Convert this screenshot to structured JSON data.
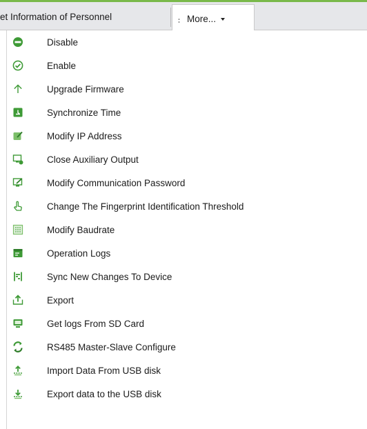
{
  "toolbar": {
    "personnel_label": "et Information of Personnel",
    "more_label": "More..."
  },
  "menu": {
    "items": [
      {
        "label": "Disable",
        "icon": "disable-icon"
      },
      {
        "label": "Enable",
        "icon": "enable-icon"
      },
      {
        "label": "Upgrade Firmware",
        "icon": "upgrade-firmware-icon"
      },
      {
        "label": "Synchronize Time",
        "icon": "synchronize-time-icon"
      },
      {
        "label": "Modify IP Address",
        "icon": "modify-ip-icon"
      },
      {
        "label": "Close Auxiliary Output",
        "icon": "close-auxiliary-output-icon"
      },
      {
        "label": "Modify Communication Password",
        "icon": "modify-communication-password-icon"
      },
      {
        "label": "Change The Fingerprint Identification Threshold",
        "icon": "fingerprint-threshold-icon"
      },
      {
        "label": "Modify Baudrate",
        "icon": "modify-baudrate-icon"
      },
      {
        "label": "Operation Logs",
        "icon": "operation-logs-icon"
      },
      {
        "label": "Sync New Changes To Device",
        "icon": "sync-changes-icon"
      },
      {
        "label": "Export",
        "icon": "export-icon"
      },
      {
        "label": "Get logs From SD Card",
        "icon": "sd-card-logs-icon"
      },
      {
        "label": "RS485 Master-Slave Configure",
        "icon": "rs485-configure-icon"
      },
      {
        "label": "Import Data From USB disk",
        "icon": "usb-import-icon"
      },
      {
        "label": "Export data to the USB disk",
        "icon": "usb-export-icon"
      }
    ]
  },
  "colors": {
    "accent_green": "#79b94a",
    "icon_green": "#3e9a36",
    "toolbar_bg": "#e6e7ea"
  }
}
